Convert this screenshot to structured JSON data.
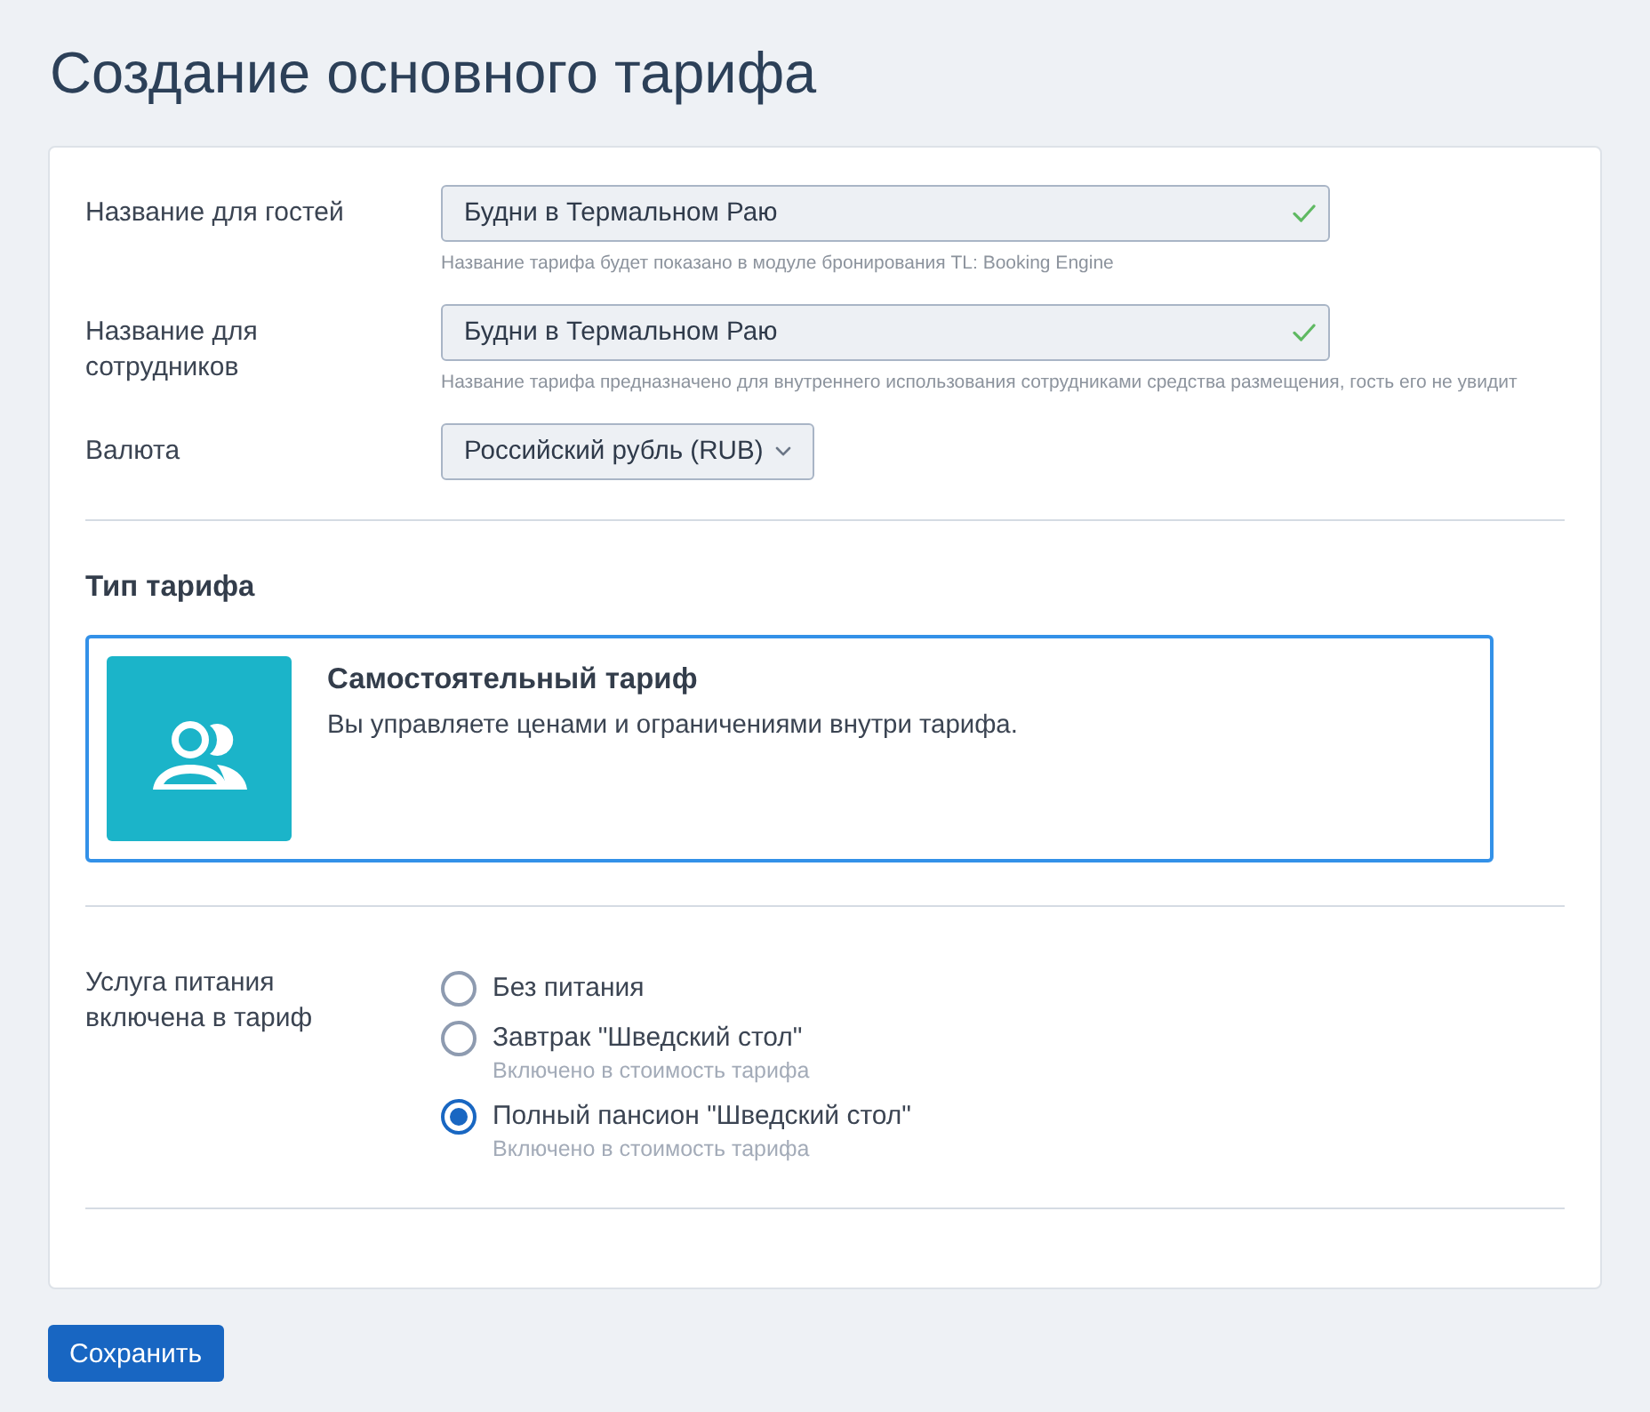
{
  "page": {
    "title": "Создание основного тарифа"
  },
  "fields": [
    {
      "kind": "text",
      "label": "Название для гостей",
      "value": "Будни в Термальном Раю",
      "valid": true,
      "hint": "Название тарифа будет показано в модуле бронирования TL: Booking Engine"
    },
    {
      "kind": "text",
      "label": "Название для сотрудников",
      "value": "Будни в Термальном Раю",
      "valid": true,
      "hint": "Название тарифа предназначено для внутреннего использования сотрудниками средства размещения, гость его не увидит"
    },
    {
      "kind": "select",
      "label": "Валюта",
      "value": "Российский рубль (RUB)"
    }
  ],
  "tariff_type": {
    "heading": "Тип тарифа",
    "options": [
      {
        "title": "Самостоятельный тариф",
        "description": "Вы управляете ценами и ограничениями внутри тарифа.",
        "selected": true
      }
    ]
  },
  "meal": {
    "label": "Услуга питания включена в тариф",
    "options": [
      {
        "label": "Без питания",
        "selected": false
      },
      {
        "label": "Завтрак \"Шведский стол\"",
        "note": "Включено в стоимость тарифа",
        "selected": false
      },
      {
        "label": "Полный пансион \"Шведский стол\"",
        "note": "Включено в стоимость тарифа",
        "selected": true
      }
    ]
  },
  "save_button": "Сохранить"
}
